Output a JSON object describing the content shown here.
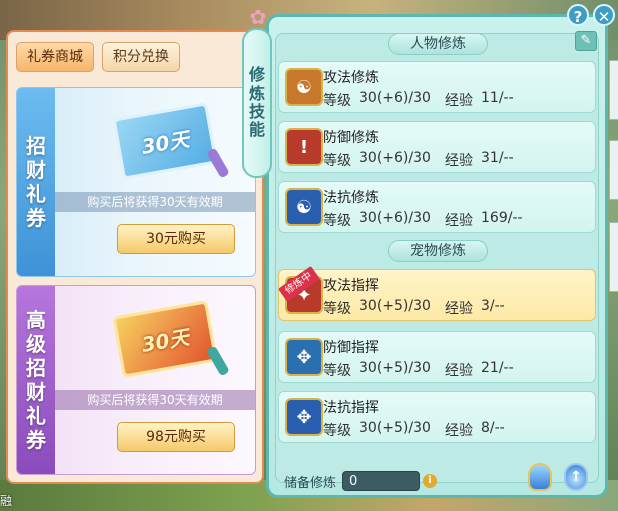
{
  "corner": {
    "text": "融"
  },
  "shop": {
    "tabs": [
      {
        "label": "礼券商城",
        "active": true
      },
      {
        "label": "积分兑换",
        "active": false
      }
    ],
    "cards": [
      {
        "side_label": "招财礼券",
        "ticket_text": "30天",
        "description": "购买后将获得30天有效期",
        "button": "30元购买"
      },
      {
        "side_label": "高级招财礼券",
        "ticket_text": "30天",
        "description": "购买后将获得30天有效期",
        "button": "98元购买"
      }
    ]
  },
  "vertical_tab": {
    "label": "修炼技能"
  },
  "panel": {
    "sections": [
      {
        "title": "人物修炼"
      },
      {
        "title": "宠物修炼"
      }
    ],
    "level_label": "等级",
    "exp_label": "经验",
    "rows": [
      {
        "name": "攻法修炼",
        "level": "30(+6)/30",
        "exp": "11/--",
        "icon": "meditating-figure-icon",
        "color": "#c7782a",
        "glyph": "☯"
      },
      {
        "name": "防御修炼",
        "level": "30(+6)/30",
        "exp": "31/--",
        "icon": "shield-icon",
        "color": "#b83a2a",
        "glyph": "!"
      },
      {
        "name": "法抗修炼",
        "level": "30(+6)/30",
        "exp": "169/--",
        "icon": "yin-yang-shield-icon",
        "color": "#2a5fb0",
        "glyph": "☯"
      },
      {
        "name": "攻法指挥",
        "level": "30(+5)/30",
        "exp": "3/--",
        "icon": "paw-icon",
        "color": "#b83a2a",
        "glyph": "✦",
        "badge": "修炼中",
        "active": true
      },
      {
        "name": "防御指挥",
        "level": "30(+5)/30",
        "exp": "21/--",
        "icon": "paw-shield-icon",
        "color": "#2a6fb0",
        "glyph": "✥"
      },
      {
        "name": "法抗指挥",
        "level": "30(+5)/30",
        "exp": "8/--",
        "icon": "paw-circle-icon",
        "color": "#2a5fb0",
        "glyph": "✥"
      }
    ],
    "reserve": {
      "label": "储备修炼",
      "value": "0"
    }
  }
}
